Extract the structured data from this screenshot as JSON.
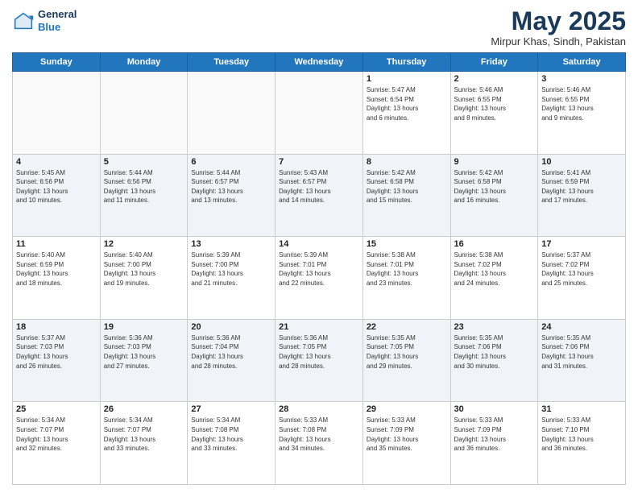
{
  "header": {
    "logo_line1": "General",
    "logo_line2": "Blue",
    "month": "May 2025",
    "location": "Mirpur Khas, Sindh, Pakistan"
  },
  "weekdays": [
    "Sunday",
    "Monday",
    "Tuesday",
    "Wednesday",
    "Thursday",
    "Friday",
    "Saturday"
  ],
  "weeks": [
    [
      {
        "day": "",
        "info": ""
      },
      {
        "day": "",
        "info": ""
      },
      {
        "day": "",
        "info": ""
      },
      {
        "day": "",
        "info": ""
      },
      {
        "day": "1",
        "info": "Sunrise: 5:47 AM\nSunset: 6:54 PM\nDaylight: 13 hours\nand 6 minutes."
      },
      {
        "day": "2",
        "info": "Sunrise: 5:46 AM\nSunset: 6:55 PM\nDaylight: 13 hours\nand 8 minutes."
      },
      {
        "day": "3",
        "info": "Sunrise: 5:46 AM\nSunset: 6:55 PM\nDaylight: 13 hours\nand 9 minutes."
      }
    ],
    [
      {
        "day": "4",
        "info": "Sunrise: 5:45 AM\nSunset: 6:56 PM\nDaylight: 13 hours\nand 10 minutes."
      },
      {
        "day": "5",
        "info": "Sunrise: 5:44 AM\nSunset: 6:56 PM\nDaylight: 13 hours\nand 11 minutes."
      },
      {
        "day": "6",
        "info": "Sunrise: 5:44 AM\nSunset: 6:57 PM\nDaylight: 13 hours\nand 13 minutes."
      },
      {
        "day": "7",
        "info": "Sunrise: 5:43 AM\nSunset: 6:57 PM\nDaylight: 13 hours\nand 14 minutes."
      },
      {
        "day": "8",
        "info": "Sunrise: 5:42 AM\nSunset: 6:58 PM\nDaylight: 13 hours\nand 15 minutes."
      },
      {
        "day": "9",
        "info": "Sunrise: 5:42 AM\nSunset: 6:58 PM\nDaylight: 13 hours\nand 16 minutes."
      },
      {
        "day": "10",
        "info": "Sunrise: 5:41 AM\nSunset: 6:59 PM\nDaylight: 13 hours\nand 17 minutes."
      }
    ],
    [
      {
        "day": "11",
        "info": "Sunrise: 5:40 AM\nSunset: 6:59 PM\nDaylight: 13 hours\nand 18 minutes."
      },
      {
        "day": "12",
        "info": "Sunrise: 5:40 AM\nSunset: 7:00 PM\nDaylight: 13 hours\nand 19 minutes."
      },
      {
        "day": "13",
        "info": "Sunrise: 5:39 AM\nSunset: 7:00 PM\nDaylight: 13 hours\nand 21 minutes."
      },
      {
        "day": "14",
        "info": "Sunrise: 5:39 AM\nSunset: 7:01 PM\nDaylight: 13 hours\nand 22 minutes."
      },
      {
        "day": "15",
        "info": "Sunrise: 5:38 AM\nSunset: 7:01 PM\nDaylight: 13 hours\nand 23 minutes."
      },
      {
        "day": "16",
        "info": "Sunrise: 5:38 AM\nSunset: 7:02 PM\nDaylight: 13 hours\nand 24 minutes."
      },
      {
        "day": "17",
        "info": "Sunrise: 5:37 AM\nSunset: 7:02 PM\nDaylight: 13 hours\nand 25 minutes."
      }
    ],
    [
      {
        "day": "18",
        "info": "Sunrise: 5:37 AM\nSunset: 7:03 PM\nDaylight: 13 hours\nand 26 minutes."
      },
      {
        "day": "19",
        "info": "Sunrise: 5:36 AM\nSunset: 7:03 PM\nDaylight: 13 hours\nand 27 minutes."
      },
      {
        "day": "20",
        "info": "Sunrise: 5:36 AM\nSunset: 7:04 PM\nDaylight: 13 hours\nand 28 minutes."
      },
      {
        "day": "21",
        "info": "Sunrise: 5:36 AM\nSunset: 7:05 PM\nDaylight: 13 hours\nand 28 minutes."
      },
      {
        "day": "22",
        "info": "Sunrise: 5:35 AM\nSunset: 7:05 PM\nDaylight: 13 hours\nand 29 minutes."
      },
      {
        "day": "23",
        "info": "Sunrise: 5:35 AM\nSunset: 7:06 PM\nDaylight: 13 hours\nand 30 minutes."
      },
      {
        "day": "24",
        "info": "Sunrise: 5:35 AM\nSunset: 7:06 PM\nDaylight: 13 hours\nand 31 minutes."
      }
    ],
    [
      {
        "day": "25",
        "info": "Sunrise: 5:34 AM\nSunset: 7:07 PM\nDaylight: 13 hours\nand 32 minutes."
      },
      {
        "day": "26",
        "info": "Sunrise: 5:34 AM\nSunset: 7:07 PM\nDaylight: 13 hours\nand 33 minutes."
      },
      {
        "day": "27",
        "info": "Sunrise: 5:34 AM\nSunset: 7:08 PM\nDaylight: 13 hours\nand 33 minutes."
      },
      {
        "day": "28",
        "info": "Sunrise: 5:33 AM\nSunset: 7:08 PM\nDaylight: 13 hours\nand 34 minutes."
      },
      {
        "day": "29",
        "info": "Sunrise: 5:33 AM\nSunset: 7:09 PM\nDaylight: 13 hours\nand 35 minutes."
      },
      {
        "day": "30",
        "info": "Sunrise: 5:33 AM\nSunset: 7:09 PM\nDaylight: 13 hours\nand 36 minutes."
      },
      {
        "day": "31",
        "info": "Sunrise: 5:33 AM\nSunset: 7:10 PM\nDaylight: 13 hours\nand 36 minutes."
      }
    ]
  ]
}
